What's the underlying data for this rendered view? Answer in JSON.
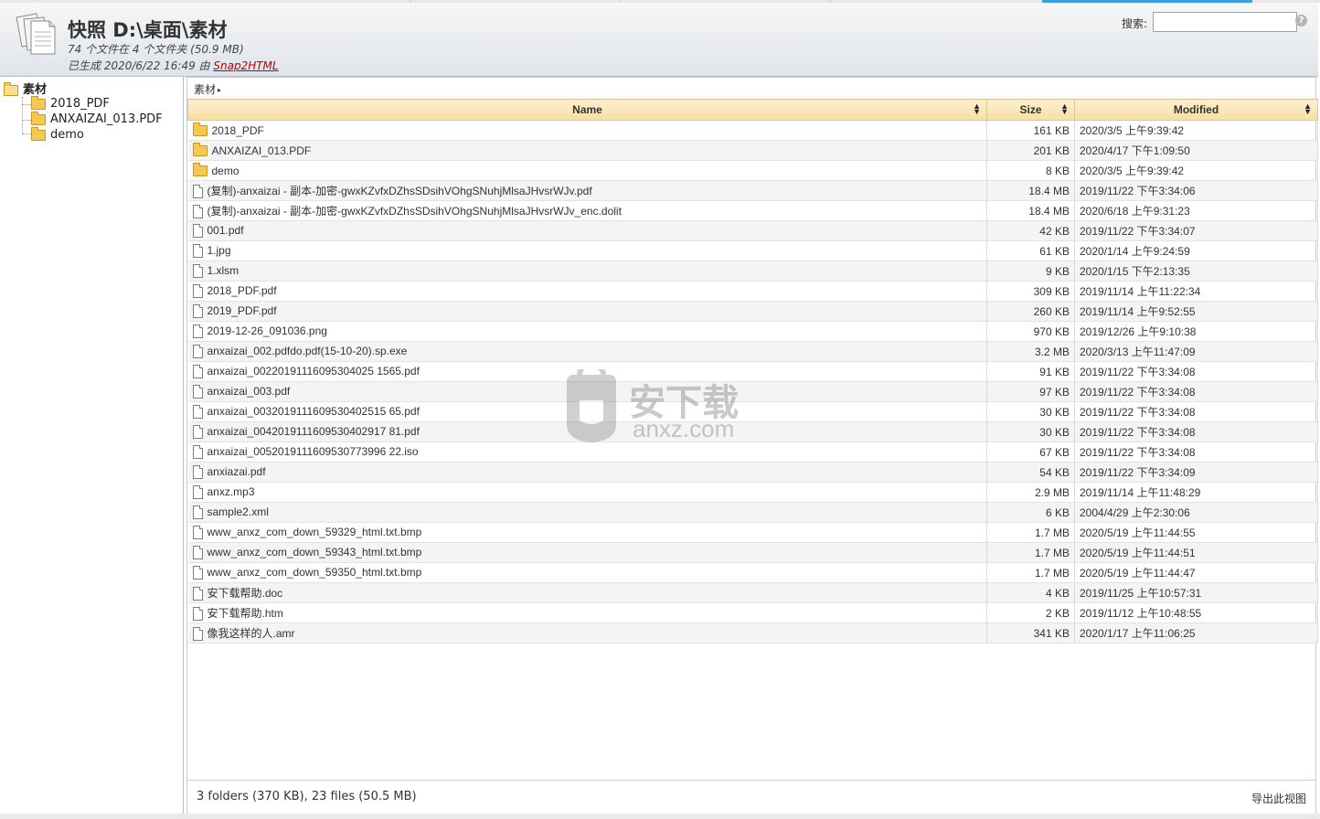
{
  "header": {
    "title": "快照 D:\\桌面\\素材",
    "subtitle": "74 个文件在 4 个文件夹 (50.9 MB)",
    "generated_prefix": "已生成 2020/6/22 16:49 由 ",
    "generated_link": "Snap2HTML",
    "search_label": "搜索:",
    "search_value": "",
    "help_glyph": "?"
  },
  "tree": {
    "root": "素材",
    "children": [
      "2018_PDF",
      "ANXAIZAI_013.PDF",
      "demo"
    ]
  },
  "breadcrumb": {
    "path": "素材",
    "arrow": "▸"
  },
  "table": {
    "columns": [
      "Name",
      "Size",
      "Modified"
    ],
    "rows": [
      {
        "type": "folder",
        "name": "2018_PDF",
        "size": "161 KB",
        "modified": "2020/3/5 上午9:39:42"
      },
      {
        "type": "folder",
        "name": "ANXAIZAI_013.PDF",
        "size": "201 KB",
        "modified": "2020/4/17 下午1:09:50"
      },
      {
        "type": "folder",
        "name": "demo",
        "size": "8 KB",
        "modified": "2020/3/5 上午9:39:42"
      },
      {
        "type": "file",
        "name": "(复制)-anxaizai - 副本-加密-gwxKZvfxDZhsSDsihVOhgSNuhjMlsaJHvsrWJv.pdf",
        "size": "18.4 MB",
        "modified": "2019/11/22 下午3:34:06"
      },
      {
        "type": "file",
        "name": "(复制)-anxaizai - 副本-加密-gwxKZvfxDZhsSDsihVOhgSNuhjMlsaJHvsrWJv_enc.dolit",
        "size": "18.4 MB",
        "modified": "2020/6/18 上午9:31:23"
      },
      {
        "type": "file",
        "name": "001.pdf",
        "size": "42 KB",
        "modified": "2019/11/22 下午3:34:07"
      },
      {
        "type": "file",
        "name": "1.jpg",
        "size": "61 KB",
        "modified": "2020/1/14 上午9:24:59"
      },
      {
        "type": "file",
        "name": "1.xlsm",
        "size": "9 KB",
        "modified": "2020/1/15 下午2:13:35"
      },
      {
        "type": "file",
        "name": "2018_PDF.pdf",
        "size": "309 KB",
        "modified": "2019/11/14 上午11:22:34"
      },
      {
        "type": "file",
        "name": "2019_PDF.pdf",
        "size": "260 KB",
        "modified": "2019/11/14 上午9:52:55"
      },
      {
        "type": "file",
        "name": "2019-12-26_091036.png",
        "size": "970 KB",
        "modified": "2019/12/26 上午9:10:38"
      },
      {
        "type": "file",
        "name": "anxaizai_002.pdfdo.pdf(15-10-20).sp.exe",
        "size": "3.2 MB",
        "modified": "2020/3/13 上午11:47:09"
      },
      {
        "type": "file",
        "name": "anxaizai_00220191116095304025 1565.pdf",
        "size": "91 KB",
        "modified": "2019/11/22 下午3:34:08"
      },
      {
        "type": "file",
        "name": "anxaizai_003.pdf",
        "size": "97 KB",
        "modified": "2019/11/22 下午3:34:08"
      },
      {
        "type": "file",
        "name": "anxaizai_0032019111609530402515 65.pdf",
        "size": "30 KB",
        "modified": "2019/11/22 下午3:34:08"
      },
      {
        "type": "file",
        "name": "anxaizai_0042019111609530402917 81.pdf",
        "size": "30 KB",
        "modified": "2019/11/22 下午3:34:08"
      },
      {
        "type": "file",
        "name": "anxaizai_0052019111609530773996 22.iso",
        "size": "67 KB",
        "modified": "2019/11/22 下午3:34:08"
      },
      {
        "type": "file",
        "name": "anxiazai.pdf",
        "size": "54 KB",
        "modified": "2019/11/22 下午3:34:09"
      },
      {
        "type": "file",
        "name": "anxz.mp3",
        "size": "2.9 MB",
        "modified": "2019/11/14 上午11:48:29"
      },
      {
        "type": "file",
        "name": "sample2.xml",
        "size": "6 KB",
        "modified": "2004/4/29 上午2:30:06"
      },
      {
        "type": "file",
        "name": "www_anxz_com_down_59329_html.txt.bmp",
        "size": "1.7 MB",
        "modified": "2020/5/19 上午11:44:55"
      },
      {
        "type": "file",
        "name": "www_anxz_com_down_59343_html.txt.bmp",
        "size": "1.7 MB",
        "modified": "2020/5/19 上午11:44:51"
      },
      {
        "type": "file",
        "name": "www_anxz_com_down_59350_html.txt.bmp",
        "size": "1.7 MB",
        "modified": "2020/5/19 上午11:44:47"
      },
      {
        "type": "file",
        "name": "安下载帮助.doc",
        "size": "4 KB",
        "modified": "2019/11/25 上午10:57:31"
      },
      {
        "type": "file",
        "name": "安下载帮助.htm",
        "size": "2 KB",
        "modified": "2019/11/12 上午10:48:55"
      },
      {
        "type": "file",
        "name": "像我这样的人.amr",
        "size": "341 KB",
        "modified": "2020/1/17 上午11:06:25"
      }
    ]
  },
  "footer": {
    "summary": "3 folders (370 KB), 23 files (50.5 MB)",
    "export": "导出此视图"
  },
  "watermark": {
    "cn": "安下载",
    "en": "anxz.com"
  }
}
